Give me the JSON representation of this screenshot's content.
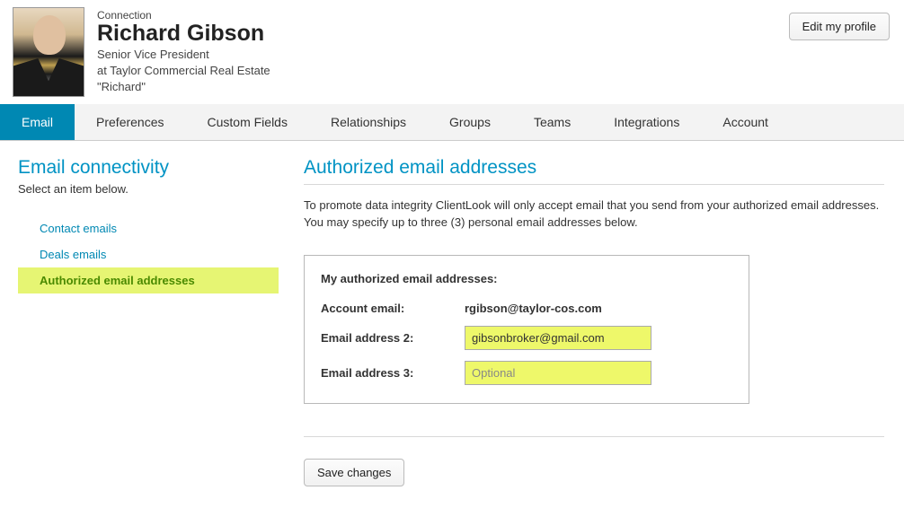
{
  "header": {
    "type_label": "Connection",
    "name": "Richard Gibson",
    "title": "Senior Vice President",
    "company_line": "at Taylor Commercial Real Estate",
    "nickname": "\"Richard\"",
    "edit_button": "Edit my profile"
  },
  "tabs": [
    {
      "label": "Email",
      "active": true
    },
    {
      "label": "Preferences",
      "active": false
    },
    {
      "label": "Custom Fields",
      "active": false
    },
    {
      "label": "Relationships",
      "active": false
    },
    {
      "label": "Groups",
      "active": false
    },
    {
      "label": "Teams",
      "active": false
    },
    {
      "label": "Integrations",
      "active": false
    },
    {
      "label": "Account",
      "active": false
    }
  ],
  "sidebar": {
    "title": "Email connectivity",
    "help": "Select an item below.",
    "items": [
      {
        "label": "Contact emails",
        "active": false
      },
      {
        "label": "Deals emails",
        "active": false
      },
      {
        "label": "Authorized email addresses",
        "active": true
      }
    ]
  },
  "main": {
    "title": "Authorized email addresses",
    "intro": "To promote data integrity ClientLook will only accept email that you send from your authorized email addresses. You may specify up to three (3) personal email addresses below.",
    "panel_title": "My authorized email addresses:",
    "account_email_label": "Account email:",
    "account_email_value": "rgibson@taylor-cos.com",
    "email2_label": "Email address 2:",
    "email2_value": "gibsonbroker@gmail.com",
    "email3_label": "Email address 3:",
    "email3_value": "",
    "email3_placeholder": "Optional",
    "save_button": "Save changes"
  }
}
